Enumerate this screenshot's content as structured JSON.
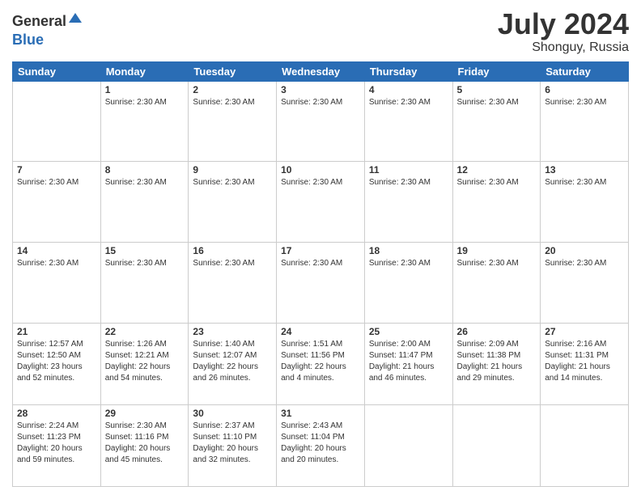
{
  "header": {
    "logo_line1": "General",
    "logo_line2": "Blue",
    "title": "July 2024",
    "subtitle": "Shonguy, Russia"
  },
  "weekdays": [
    "Sunday",
    "Monday",
    "Tuesday",
    "Wednesday",
    "Thursday",
    "Friday",
    "Saturday"
  ],
  "weeks": [
    [
      {
        "day": "",
        "info": ""
      },
      {
        "day": "1",
        "info": "Sunrise: 2:30 AM"
      },
      {
        "day": "2",
        "info": "Sunrise: 2:30 AM"
      },
      {
        "day": "3",
        "info": "Sunrise: 2:30 AM"
      },
      {
        "day": "4",
        "info": "Sunrise: 2:30 AM"
      },
      {
        "day": "5",
        "info": "Sunrise: 2:30 AM"
      },
      {
        "day": "6",
        "info": "Sunrise: 2:30 AM"
      }
    ],
    [
      {
        "day": "7",
        "info": "Sunrise: 2:30 AM"
      },
      {
        "day": "8",
        "info": "Sunrise: 2:30 AM"
      },
      {
        "day": "9",
        "info": "Sunrise: 2:30 AM"
      },
      {
        "day": "10",
        "info": "Sunrise: 2:30 AM"
      },
      {
        "day": "11",
        "info": "Sunrise: 2:30 AM"
      },
      {
        "day": "12",
        "info": "Sunrise: 2:30 AM"
      },
      {
        "day": "13",
        "info": "Sunrise: 2:30 AM"
      }
    ],
    [
      {
        "day": "14",
        "info": "Sunrise: 2:30 AM"
      },
      {
        "day": "15",
        "info": "Sunrise: 2:30 AM"
      },
      {
        "day": "16",
        "info": "Sunrise: 2:30 AM"
      },
      {
        "day": "17",
        "info": "Sunrise: 2:30 AM"
      },
      {
        "day": "18",
        "info": "Sunrise: 2:30 AM"
      },
      {
        "day": "19",
        "info": "Sunrise: 2:30 AM"
      },
      {
        "day": "20",
        "info": "Sunrise: 2:30 AM"
      }
    ],
    [
      {
        "day": "21",
        "info": "Sunrise: 12:57 AM\nSunset: 12:50 AM\nDaylight: 23 hours and 52 minutes."
      },
      {
        "day": "22",
        "info": "Sunrise: 1:26 AM\nSunset: 12:21 AM\nDaylight: 22 hours and 54 minutes."
      },
      {
        "day": "23",
        "info": "Sunrise: 1:40 AM\nSunset: 12:07 AM\nDaylight: 22 hours and 26 minutes."
      },
      {
        "day": "24",
        "info": "Sunrise: 1:51 AM\nSunset: 11:56 PM\nDaylight: 22 hours and 4 minutes."
      },
      {
        "day": "25",
        "info": "Sunrise: 2:00 AM\nSunset: 11:47 PM\nDaylight: 21 hours and 46 minutes."
      },
      {
        "day": "26",
        "info": "Sunrise: 2:09 AM\nSunset: 11:38 PM\nDaylight: 21 hours and 29 minutes."
      },
      {
        "day": "27",
        "info": "Sunrise: 2:16 AM\nSunset: 11:31 PM\nDaylight: 21 hours and 14 minutes."
      }
    ],
    [
      {
        "day": "28",
        "info": "Sunrise: 2:24 AM\nSunset: 11:23 PM\nDaylight: 20 hours and 59 minutes."
      },
      {
        "day": "29",
        "info": "Sunrise: 2:30 AM\nSunset: 11:16 PM\nDaylight: 20 hours and 45 minutes."
      },
      {
        "day": "30",
        "info": "Sunrise: 2:37 AM\nSunset: 11:10 PM\nDaylight: 20 hours and 32 minutes."
      },
      {
        "day": "31",
        "info": "Sunrise: 2:43 AM\nSunset: 11:04 PM\nDaylight: 20 hours and 20 minutes."
      },
      {
        "day": "",
        "info": ""
      },
      {
        "day": "",
        "info": ""
      },
      {
        "day": "",
        "info": ""
      }
    ]
  ]
}
